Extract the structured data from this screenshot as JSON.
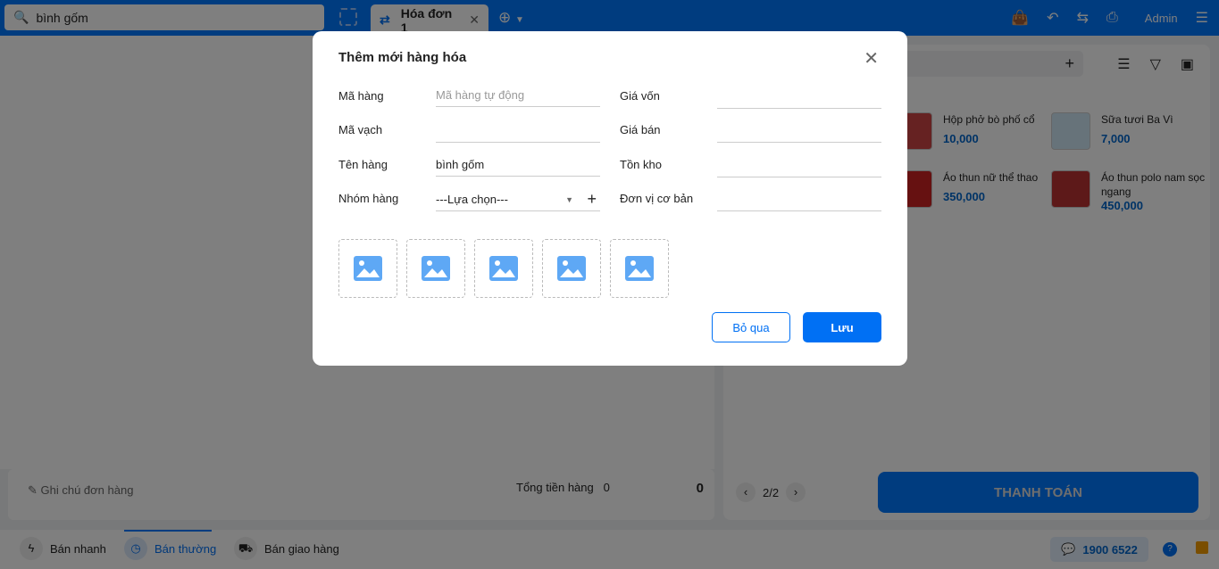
{
  "topbar": {
    "search_value": "bình gốm",
    "tab_label": "Hóa đơn 1",
    "user": "Admin"
  },
  "products": [
    {
      "name": "Hộp phở bò phố cổ",
      "price": "10,000"
    },
    {
      "name": "Sữa tươi Ba Vì",
      "price": "7,000"
    },
    {
      "name": "Áo thun nữ thể thao",
      "price": "350,000"
    },
    {
      "name": "Áo thun polo nam sọc ngang",
      "price": "450,000"
    }
  ],
  "pager": "2/2",
  "pay_label": "THANH TOÁN",
  "order": {
    "note_placeholder": "Ghi chú đơn hàng",
    "total_label": "Tổng tiền hàng",
    "total_qty": "0",
    "total_value": "0"
  },
  "modes": [
    "Bán nhanh",
    "Bán thường",
    "Bán giao hàng"
  ],
  "hotline": "1900 6522",
  "modal": {
    "title": "Thêm mới hàng hóa",
    "ma_hang_label": "Mã hàng",
    "ma_hang_placeholder": "Mã hàng tự động",
    "ma_vach_label": "Mã vạch",
    "ten_hang_label": "Tên hàng",
    "ten_hang_value": "bình gốm",
    "nhom_hang_label": "Nhóm hàng",
    "nhom_hang_value": "---Lựa chọn---",
    "gia_von_label": "Giá vốn",
    "gia_ban_label": "Giá bán",
    "ton_kho_label": "Tồn kho",
    "don_vi_label": "Đơn vị cơ bản",
    "skip_label": "Bỏ qua",
    "save_label": "Lưu"
  }
}
